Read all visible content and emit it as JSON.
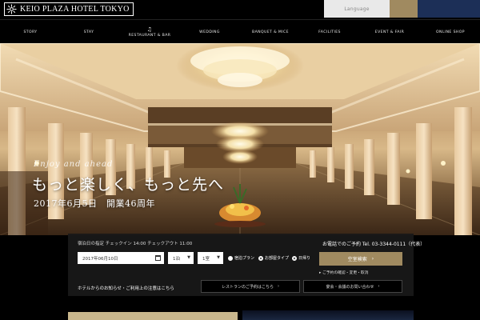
{
  "header": {
    "logo_text": "KEIO PLAZA HOTEL TOKYO",
    "language_label": "Language"
  },
  "nav": {
    "items": [
      {
        "label": "STORY"
      },
      {
        "label": "STAY"
      },
      {
        "label": "RESTAURANT & BAR"
      },
      {
        "label": "WEDDING"
      },
      {
        "label": "BANQUET & MICE"
      },
      {
        "label": "FACILITIES"
      },
      {
        "label": "EVENT & FAIR"
      },
      {
        "label": "ONLINE SHOP"
      }
    ]
  },
  "hero": {
    "script": "Enjoy and ahead",
    "headline": "もっと楽しく、もっと先へ",
    "subline": "2017年6月5日　開業46周年"
  },
  "booking": {
    "date_label": "宿泊日の指定",
    "checkin_note": "チェックイン 14:00",
    "checkout_note": "チェックアウト 11:00",
    "tel": "お電話でのご予約 Tel. 03-3344-0111（代表）",
    "date_value": "2017年06月10日",
    "nights_value": "1泊",
    "rooms_value": "1室",
    "radio_1": "宿泊プラン",
    "radio_2": "お部屋タイプ",
    "radio_3": "日帰り",
    "search_label": "空室検索",
    "link_label": "ご予約の確認・変更・取消",
    "note": "ホテルからのお知らせ・ご利用上の注意はこちら",
    "btn_1": "レストランのご予約はこちら",
    "btn_2": "宴会・会議のお問い合わせ"
  },
  "colors": {
    "accent_gold": "#a08a60",
    "navy": "#1c2f57"
  }
}
